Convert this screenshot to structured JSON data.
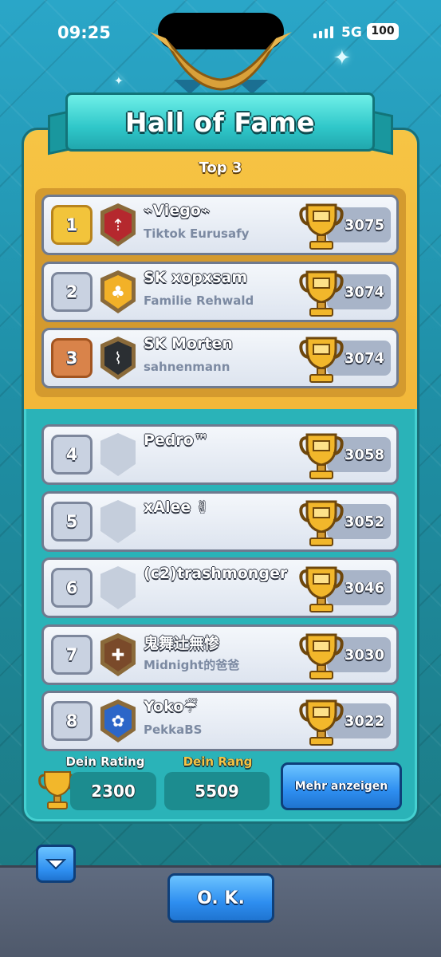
{
  "status_bar": {
    "time": "09:25",
    "network": "5G",
    "battery": "100"
  },
  "screen": {
    "title": "Hall of Fame",
    "top_label": "Top 3"
  },
  "players": [
    {
      "rank": "1",
      "name": "⌁Viego⌁",
      "clan": "Tiktok Eurusafy",
      "trophies": "3075",
      "badge_icon": "rocket-icon",
      "badge_color": "#b5282e"
    },
    {
      "rank": "2",
      "name": "SK xopxsam",
      "clan": "Familie Rehwald",
      "trophies": "3074",
      "badge_icon": "tree-icon",
      "badge_color": "#f2b128"
    },
    {
      "rank": "3",
      "name": "SK Morten",
      "clan": "sahnenmann",
      "trophies": "3074",
      "badge_icon": "bamboo-icon",
      "badge_color": "#2b2f33"
    },
    {
      "rank": "4",
      "name": "Pedro™",
      "clan": "",
      "trophies": "3058",
      "badge_icon": "empty-badge-icon",
      "badge_color": "#c5cedc"
    },
    {
      "rank": "5",
      "name": "xAlee ✌",
      "clan": "",
      "trophies": "3052",
      "badge_icon": "empty-badge-icon",
      "badge_color": "#c5cedc"
    },
    {
      "rank": "6",
      "name": "(c2)trashmonger",
      "clan": "",
      "trophies": "3046",
      "badge_icon": "empty-badge-icon",
      "badge_color": "#c5cedc"
    },
    {
      "rank": "7",
      "name": "鬼舞辻無惨",
      "clan": "Midnight的爸爸",
      "trophies": "3030",
      "badge_icon": "cross-icon",
      "badge_color": "#7a4a2a"
    },
    {
      "rank": "8",
      "name": "Yoko☔",
      "clan": "PekkaBS",
      "trophies": "3022",
      "badge_icon": "flower-icon",
      "badge_color": "#2c66c8"
    }
  ],
  "footer": {
    "rating_label": "Dein Rating",
    "rating_value": "2300",
    "rank_label": "Dein Rang",
    "rank_value": "5509",
    "more_button": "Mehr anzeigen"
  },
  "ok_button": "O. K.",
  "colors": {
    "gold": "#f2c43b",
    "teal": "#2ab3b8",
    "button_blue": "#2e8ef0",
    "rank_label_yellow": "#f6c444"
  }
}
